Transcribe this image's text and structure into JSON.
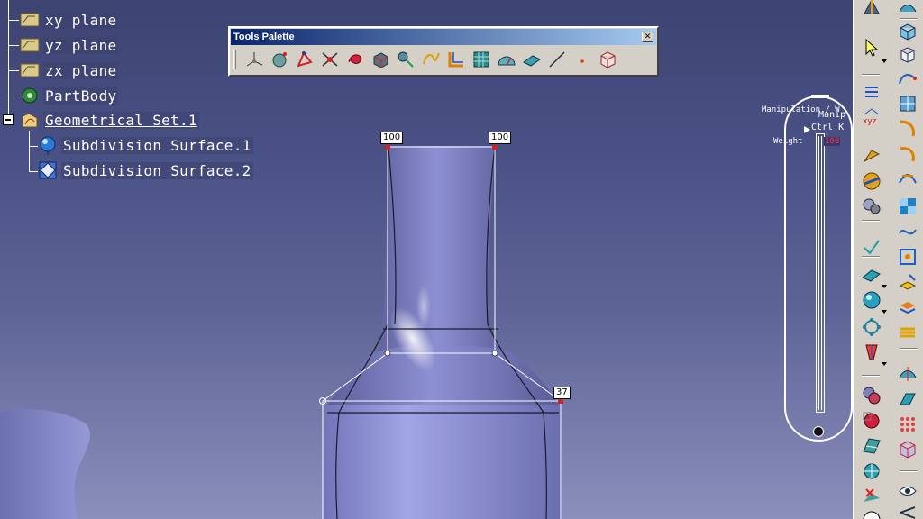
{
  "tree": {
    "items": [
      {
        "label": "xy plane",
        "icon": "plane-icon"
      },
      {
        "label": "yz plane",
        "icon": "plane-icon"
      },
      {
        "label": "zx plane",
        "icon": "plane-icon"
      },
      {
        "label": "PartBody",
        "icon": "part-body-icon"
      },
      {
        "label": "Geometrical Set.1",
        "icon": "geometrical-set-icon"
      },
      {
        "label": "Subdivision Surface.1",
        "icon": "subdivision-surface-icon"
      },
      {
        "label": "Subdivision Surface.2",
        "icon": "subdivision-surface-icon"
      }
    ]
  },
  "tools_palette": {
    "title": "Tools Palette",
    "close": "✕",
    "tools": [
      "axis-icon",
      "sphere-point-icon",
      "vertex-select-icon",
      "edge-select-icon",
      "twist-icon",
      "face-icon",
      "attract-icon",
      "path-icon",
      "corner-icon",
      "grid-icon",
      "protractor-icon",
      "plane-face-icon",
      "line-icon",
      "point-icon",
      "cube-icon"
    ]
  },
  "viewport": {
    "weights": [
      "100",
      "100",
      "37"
    ]
  },
  "manipulator": {
    "title": "Manipulation / W",
    "manip_line": "Manip",
    "ctrl_line": "Ctrl K",
    "weight_label": "Weight",
    "weight_value": "100"
  },
  "colors": {
    "background_top": "#3d4472",
    "background_bottom": "#8a8fbb",
    "surface": "#7d80c4",
    "toolbar": "#d4d0c8",
    "titlebar": "#0a246a"
  }
}
